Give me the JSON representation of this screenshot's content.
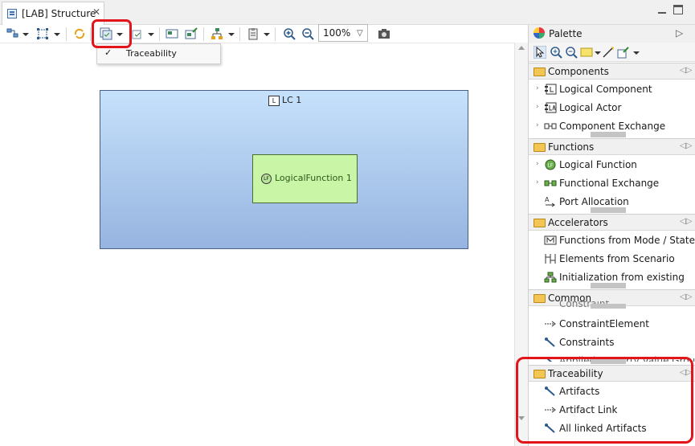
{
  "editor": {
    "tab_title": "[LAB] Structure",
    "close_glyph": "✕"
  },
  "toolbar": {
    "zoom_value": "100%",
    "zoom_arrow": "▽",
    "icons": [
      "arrange-icon",
      "select-icon",
      "refresh-icon",
      "filter-icon",
      "layers-icon",
      "show-hide-icon",
      "pin-icon",
      "tree-layout-icon",
      "paste-format-icon",
      "zoom-in-icon",
      "zoom-out-icon",
      "camera-icon"
    ]
  },
  "menu": {
    "check": "✓",
    "item_label": "Traceability"
  },
  "diagram": {
    "lc_icon_text": "L",
    "lc_name": "LC 1",
    "lf_icon_text": "LF",
    "lf_name": "LogicalFunction 1"
  },
  "palette": {
    "title": "Palette",
    "chevron": "▷",
    "sections": [
      {
        "name": "Components",
        "items": [
          "Logical Component",
          "Logical Actor",
          "Component Exchange"
        ]
      },
      {
        "name": "Functions",
        "items": [
          "Logical Function",
          "Functional Exchange",
          "Port Allocation"
        ]
      },
      {
        "name": "Accelerators",
        "items": [
          "Functions from Mode / State",
          "Elements from Scenario",
          "Initialization from existing"
        ]
      },
      {
        "name": "Common",
        "items": [
          "Constraint",
          "ConstraintElement",
          "Constraints",
          "Applied Property Value Group"
        ]
      },
      {
        "name": "Traceability",
        "items": [
          "Artifacts",
          "Artifact Link",
          "All linked Artifacts"
        ]
      }
    ],
    "collapse_arrow": "◁▷",
    "expand_arrow": "›"
  },
  "colors": {
    "highlight": "#e4141b",
    "component_fill": "#c6e1fb",
    "function_fill": "#c9f5a6"
  }
}
